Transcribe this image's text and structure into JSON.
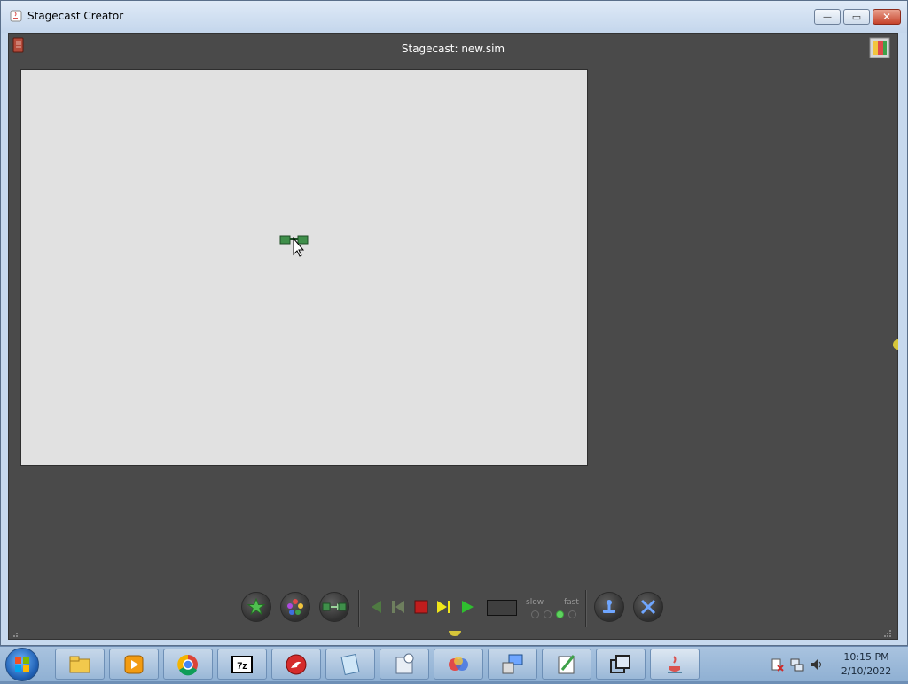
{
  "window": {
    "title": "Stagecast Creator",
    "minimize_glyph": "—",
    "maximize_glyph": "▭",
    "close_glyph": "✕"
  },
  "document": {
    "title": "Stagecast: new.sim"
  },
  "toolbar": {
    "speed_slow": "slow",
    "speed_fast": "fast",
    "speed_level": 3,
    "speed_levels": 4
  },
  "taskbar": {
    "items": [
      "file-explorer-icon",
      "media-player-icon",
      "chrome-icon",
      "7zip-icon",
      "red-app-icon",
      "notepad-icon",
      "calculator-icon",
      "colorful-app-icon",
      "remote-desktop-icon",
      "edit-icon",
      "window-switch-icon",
      "java-icon"
    ],
    "time": "10:15 PM",
    "date": "2/10/2022"
  },
  "colors": {
    "client_bg": "#4a4a4a",
    "stage_bg": "#e1e1e1",
    "accent_green": "#3f8f4a"
  }
}
